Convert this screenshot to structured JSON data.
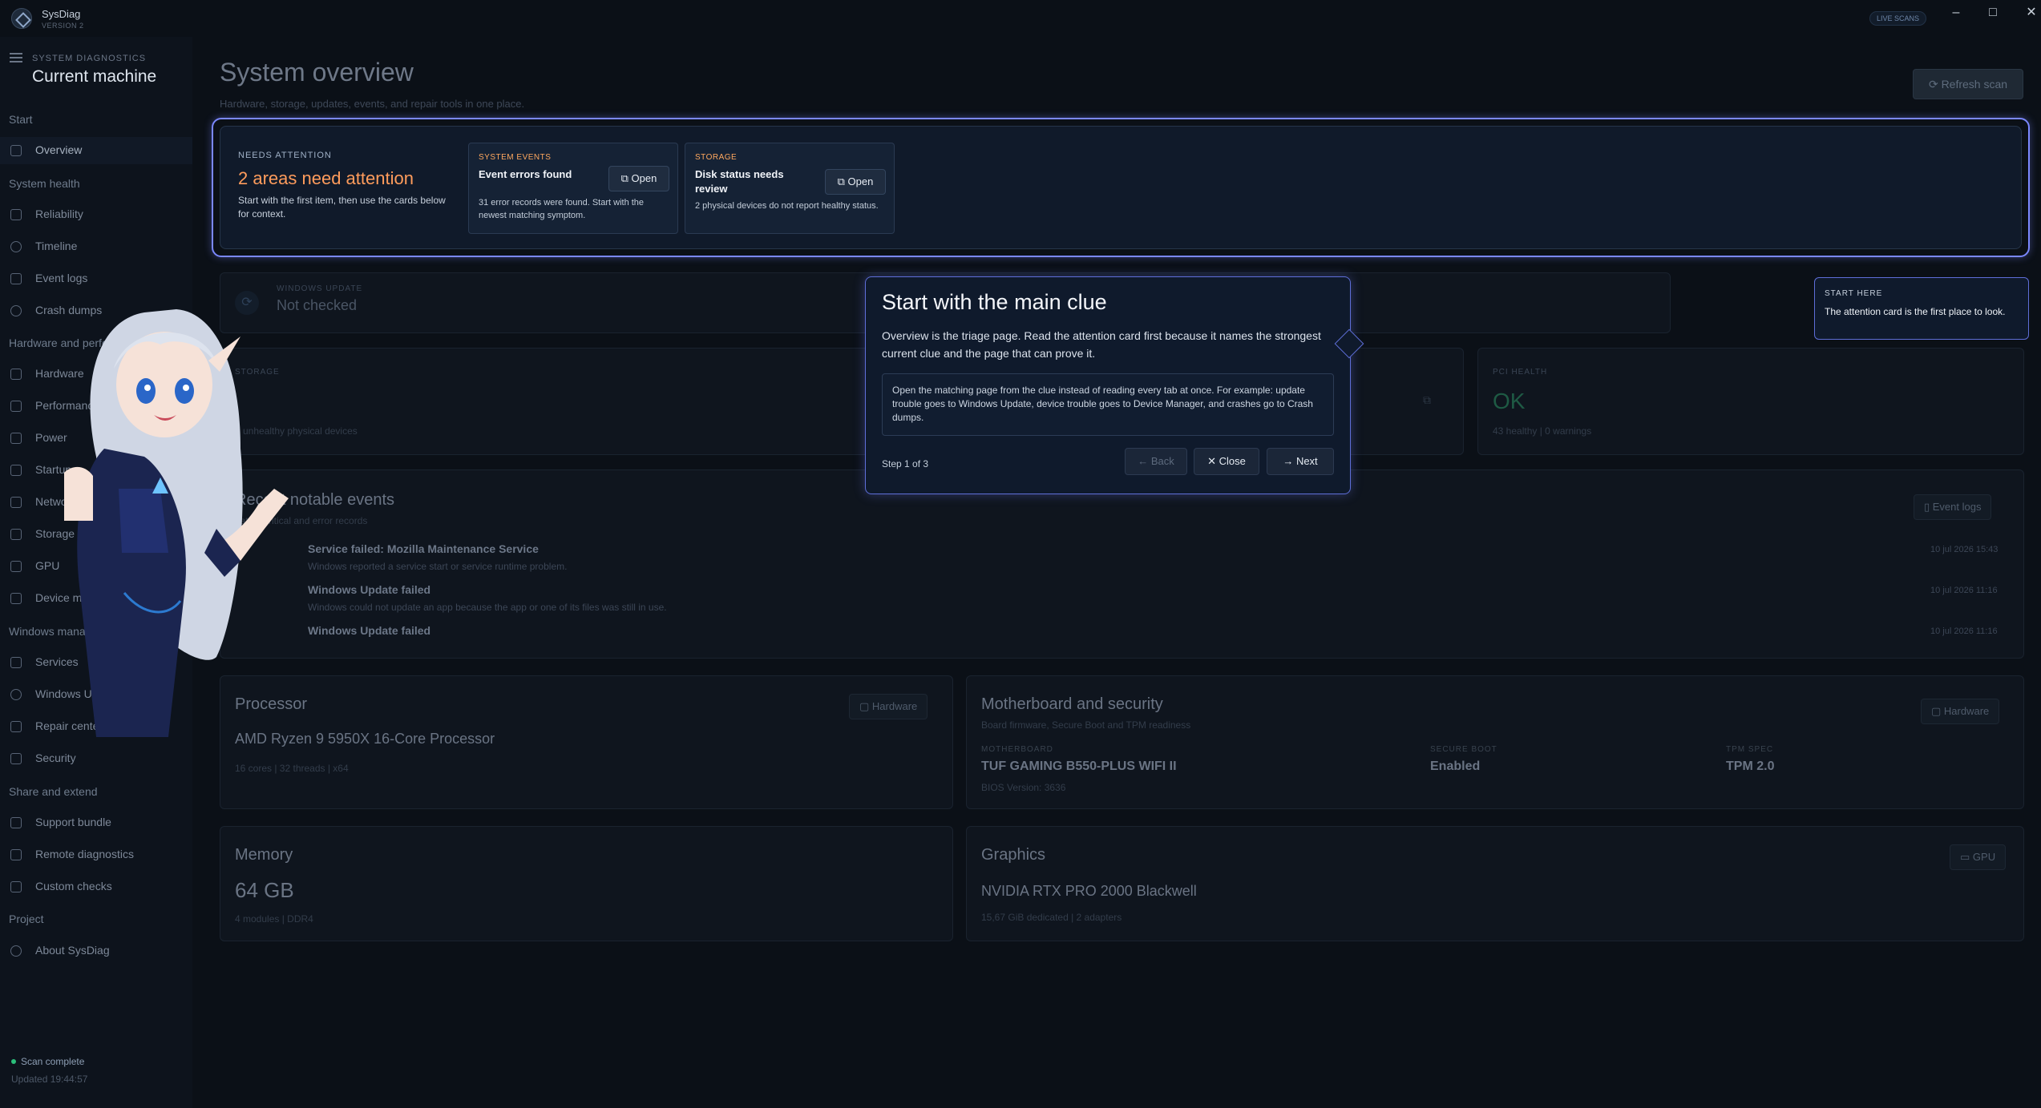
{
  "app": {
    "name": "SysDiag",
    "version": "VERSION 2",
    "live_badge": "LIVE SCANS",
    "window_controls": {
      "minimize": "–",
      "maximize": "□",
      "close": "✕"
    }
  },
  "sidebar": {
    "eyebrow": "SYSTEM DIAGNOSTICS",
    "title": "Current machine",
    "sections": [
      {
        "label": "Start",
        "items": [
          {
            "label": "Overview",
            "icon": "home-icon",
            "active": true
          }
        ]
      },
      {
        "label": "System health",
        "items": [
          {
            "label": "Reliability",
            "icon": "chart-icon"
          },
          {
            "label": "Timeline",
            "icon": "clock-icon"
          },
          {
            "label": "Event logs",
            "icon": "log-icon"
          },
          {
            "label": "Crash dumps",
            "icon": "alert-icon"
          }
        ]
      },
      {
        "label": "Hardware and performance",
        "items": [
          {
            "label": "Hardware",
            "icon": "chip-icon"
          },
          {
            "label": "Performance",
            "icon": "gauge-icon"
          },
          {
            "label": "Power",
            "icon": "battery-icon"
          },
          {
            "label": "Startup",
            "icon": "rocket-icon"
          },
          {
            "label": "Network",
            "icon": "network-icon"
          },
          {
            "label": "Storage",
            "icon": "disk-icon"
          },
          {
            "label": "GPU",
            "icon": "monitor-icon"
          },
          {
            "label": "Device manager",
            "icon": "device-icon"
          }
        ]
      },
      {
        "label": "Windows management",
        "items": [
          {
            "label": "Services",
            "icon": "wrench-icon"
          },
          {
            "label": "Windows Update",
            "icon": "refresh-icon"
          },
          {
            "label": "Repair center",
            "icon": "tool-icon"
          },
          {
            "label": "Security",
            "icon": "lock-icon"
          }
        ]
      },
      {
        "label": "Share and extend",
        "items": [
          {
            "label": "Support bundle",
            "icon": "package-icon"
          },
          {
            "label": "Remote diagnostics",
            "icon": "remote-icon"
          },
          {
            "label": "Custom checks",
            "icon": "puzzle-icon"
          }
        ]
      },
      {
        "label": "Project",
        "items": [
          {
            "label": "About SysDiag",
            "icon": "info-icon"
          }
        ]
      }
    ],
    "status": "Scan complete",
    "status_sub": "Updated 19:44:57"
  },
  "page": {
    "title": "System overview",
    "subtitle": "Hardware, storage, updates, events, and repair tools in one place.",
    "refresh_label": "Refresh scan"
  },
  "attention": {
    "eyebrow": "NEEDS ATTENTION",
    "title": "2 areas need attention",
    "desc": "Start with the first item, then use the cards below for context.",
    "cards": [
      {
        "category": "SYSTEM EVENTS",
        "title": "Event errors found",
        "desc": "31 error records were found. Start with the newest matching symptom.",
        "open": "Open"
      },
      {
        "category": "STORAGE",
        "title": "Disk status needs review",
        "desc": "2 physical devices do not report healthy status.",
        "open": "Open"
      }
    ]
  },
  "update_card": {
    "eyebrow": "WINDOWS UPDATE",
    "value": "Not checked"
  },
  "storage_card": {
    "eyebrow": "STORAGE",
    "sub": "2 unhealthy physical devices"
  },
  "pci_card": {
    "eyebrow": "PCI HEALTH",
    "value": "OK",
    "sub": "43 healthy | 0 warnings"
  },
  "events": {
    "title": "Recent notable events",
    "sub": "Latest critical and error records",
    "button": "Event logs",
    "items": [
      {
        "title": "Service failed: Mozilla Maintenance Service",
        "desc": "Windows reported a service start or service runtime problem.",
        "date": "10 jul 2026 15:43"
      },
      {
        "title": "Windows Update failed",
        "desc": "Windows could not update an app because the app or one of its files was still in use.",
        "date": "10 jul 2026 11:16"
      },
      {
        "title": "Windows Update failed",
        "desc": "",
        "date": "10 jul 2026 11:16"
      }
    ]
  },
  "processor": {
    "title": "Processor",
    "button": "Hardware",
    "value": "AMD Ryzen 9 5950X 16-Core Processor",
    "sub": "16 cores | 32 threads | x64"
  },
  "motherboard": {
    "title": "Motherboard and security",
    "sub": "Board firmware, Secure Boot and TPM readiness",
    "button": "Hardware",
    "mb_label": "MOTHERBOARD",
    "mb_value": "TUF GAMING B550-PLUS WIFI II",
    "mb_sub": "BIOS Version: 3636",
    "sb_label": "SECURE BOOT",
    "sb_value": "Enabled",
    "tpm_label": "TPM SPEC",
    "tpm_value": "TPM 2.0"
  },
  "memory": {
    "title": "Memory",
    "value": "64 GB",
    "sub": "4 modules | DDR4"
  },
  "graphics": {
    "title": "Graphics",
    "button": "GPU",
    "value": "NVIDIA RTX PRO 2000 Blackwell",
    "sub": "15,67 GiB dedicated | 2 adapters"
  },
  "tour": {
    "title": "Start with the main clue",
    "desc": "Overview is the triage page. Read the attention card first because it names the strongest current clue and the page that can prove it.",
    "tip": "Open the matching page from the clue instead of reading every tab at once. For example: update trouble goes to Windows Update, device trouble goes to Device Manager, and crashes go to Crash dumps.",
    "step": "Step 1 of 3",
    "back": "Back",
    "close": "Close",
    "next": "Next"
  },
  "start_here": {
    "eyebrow": "START HERE",
    "text": "The attention card is the first place to look."
  }
}
